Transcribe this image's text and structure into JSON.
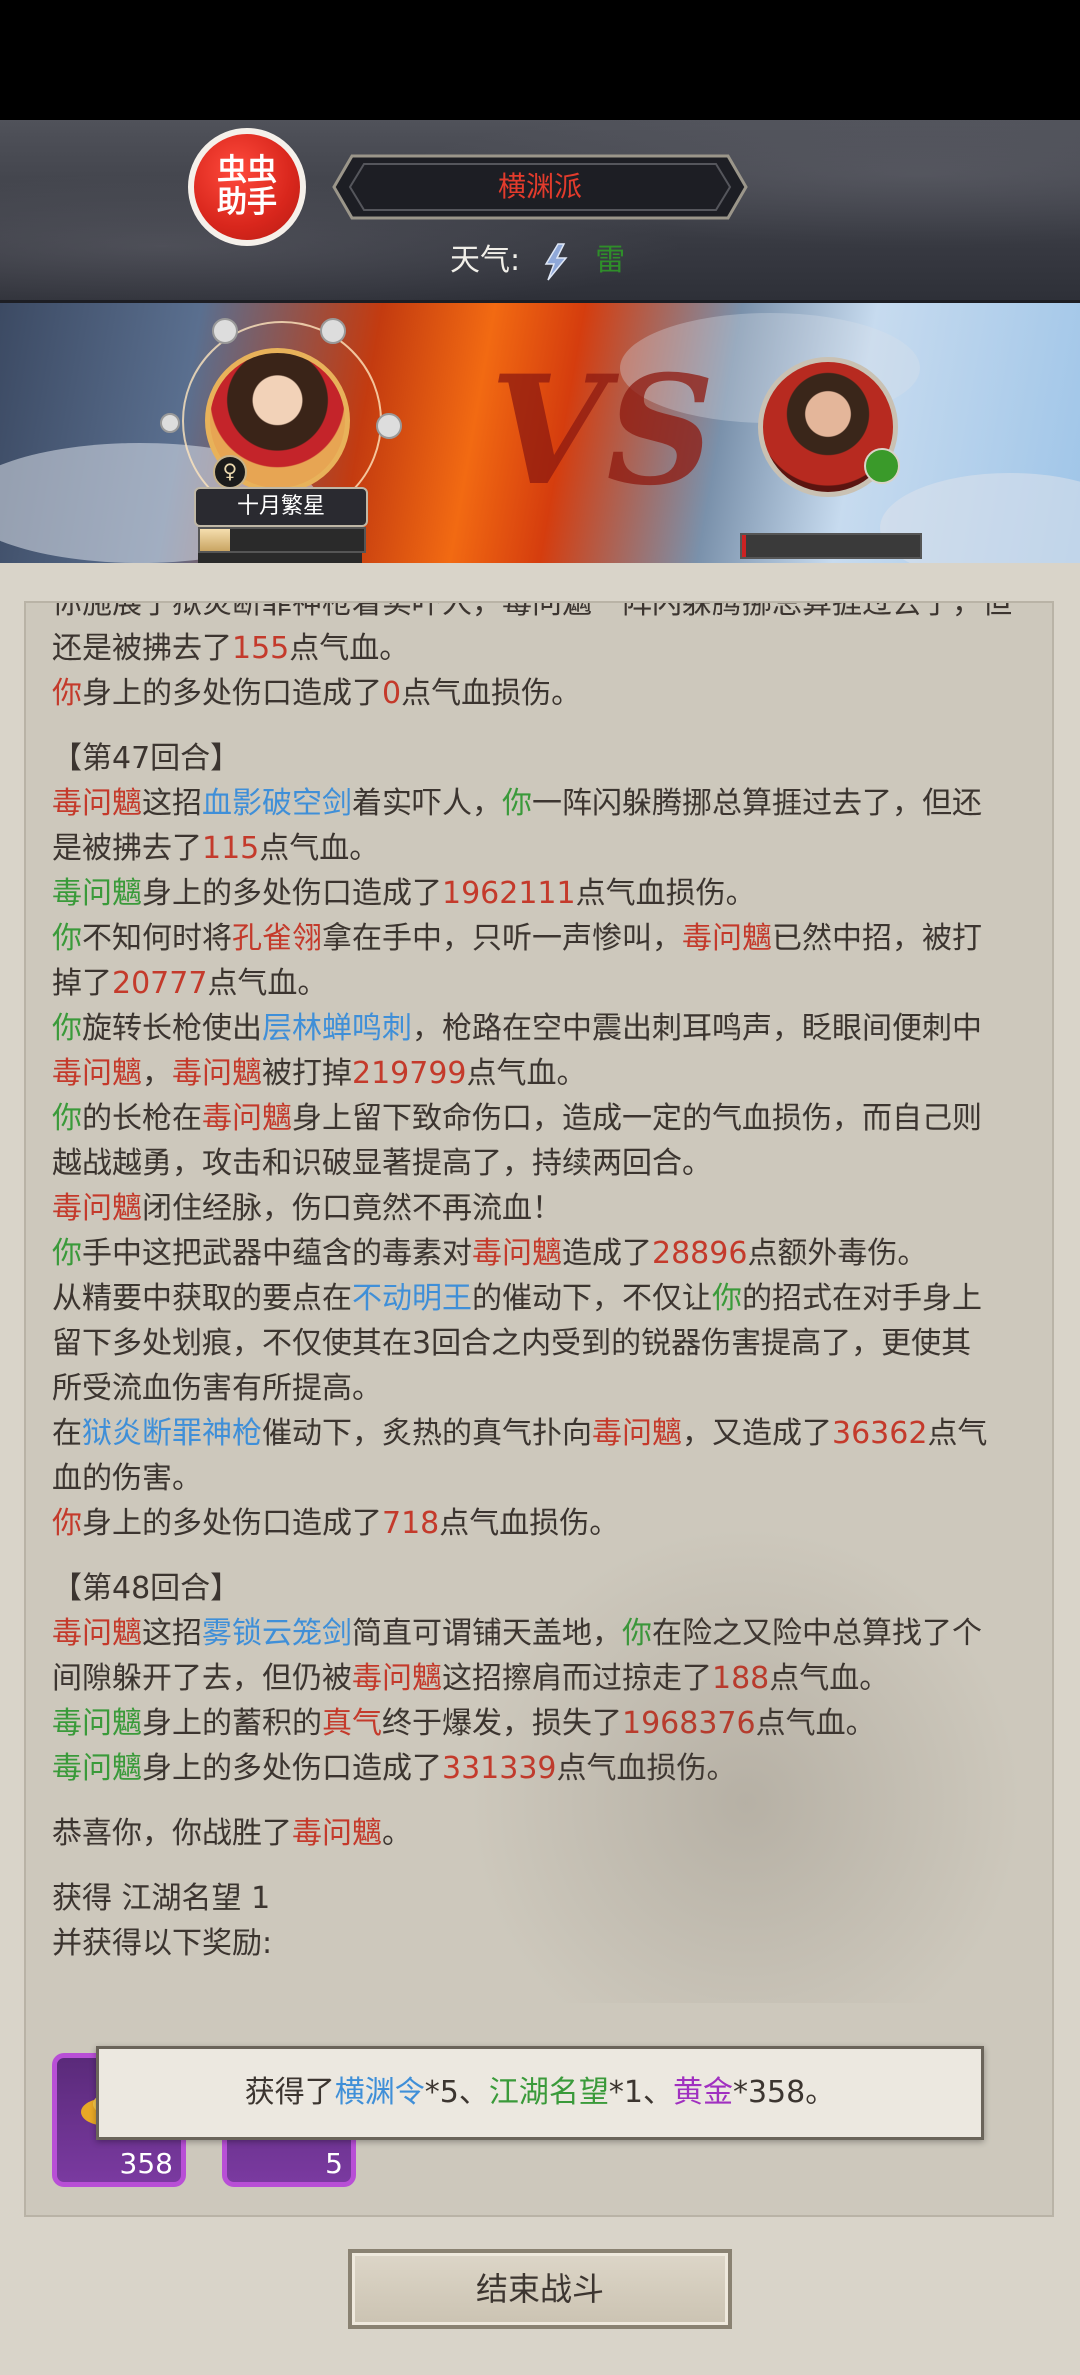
{
  "header": {
    "helper_label": "虫虫助手",
    "sect_name": "横渊派",
    "weather_label": "天气:",
    "weather_value": "雷",
    "weather_icon": "lightning-icon"
  },
  "battle": {
    "vs_text": "VS",
    "player_name": "十月繁星",
    "player_hp_fraction": 0.18,
    "enemy_hp_fraction": 0.02
  },
  "log": {
    "lines": [
      [
        {
          "t": "你施展了",
          "c": "cut"
        },
        {
          "t": "狱炎断罪神枪",
          "c": "cut"
        },
        {
          "t": "着实吓人，",
          "c": "cut"
        },
        {
          "t": "毒问魑",
          "c": "cut"
        },
        {
          "t": "一阵闪躲腾挪总算捱过去了，但",
          "c": "cut"
        }
      ],
      [
        {
          "t": "还是被拂去了"
        },
        {
          "t": "155",
          "c": "n"
        },
        {
          "t": "点气血。"
        }
      ],
      [
        {
          "t": "你",
          "c": "r"
        },
        {
          "t": "身上的多处伤口造成了"
        },
        {
          "t": "0",
          "c": "n"
        },
        {
          "t": "点气血损伤。"
        }
      ],
      "gap",
      [
        {
          "t": "【第47回合】"
        }
      ],
      [
        {
          "t": "毒问魑",
          "c": "r"
        },
        {
          "t": "这招"
        },
        {
          "t": "血影破空剑",
          "c": "b"
        },
        {
          "t": "着实吓人，"
        },
        {
          "t": "你",
          "c": "g"
        },
        {
          "t": "一阵闪躲腾挪总算捱过去了，但还"
        }
      ],
      [
        {
          "t": "是被拂去了"
        },
        {
          "t": "115",
          "c": "n"
        },
        {
          "t": "点气血。"
        }
      ],
      [
        {
          "t": "毒问魑",
          "c": "g"
        },
        {
          "t": "身上的多处伤口造成了"
        },
        {
          "t": "1962111",
          "c": "n"
        },
        {
          "t": "点气血损伤。"
        }
      ],
      [
        {
          "t": "你",
          "c": "g"
        },
        {
          "t": "不知何时将"
        },
        {
          "t": "孔雀翎",
          "c": "r"
        },
        {
          "t": "拿在手中，只听一声惨叫，"
        },
        {
          "t": "毒问魑",
          "c": "r"
        },
        {
          "t": "已然中招，被打"
        }
      ],
      [
        {
          "t": "掉了"
        },
        {
          "t": "20777",
          "c": "n"
        },
        {
          "t": "点气血。"
        }
      ],
      [
        {
          "t": "你",
          "c": "g"
        },
        {
          "t": "旋转长枪使出"
        },
        {
          "t": "层林蝉鸣刺",
          "c": "b"
        },
        {
          "t": "，枪路在空中震出刺耳鸣声，眨眼间便刺中"
        }
      ],
      [
        {
          "t": "毒问魑",
          "c": "r"
        },
        {
          "t": "，"
        },
        {
          "t": "毒问魑",
          "c": "r"
        },
        {
          "t": "被打掉"
        },
        {
          "t": "219799",
          "c": "n"
        },
        {
          "t": "点气血。"
        }
      ],
      [
        {
          "t": "你",
          "c": "g"
        },
        {
          "t": "的长枪在"
        },
        {
          "t": "毒问魑",
          "c": "r"
        },
        {
          "t": "身上留下致命伤口，造成一定的气血损伤，而自己则"
        }
      ],
      [
        {
          "t": "越战越勇，攻击和识破显著提高了，持续两回合。"
        }
      ],
      [
        {
          "t": "毒问魑",
          "c": "r"
        },
        {
          "t": "闭住经脉，伤口竟然不再流血！"
        }
      ],
      [
        {
          "t": "你",
          "c": "g"
        },
        {
          "t": "手中这把武器中蕴含的毒素对"
        },
        {
          "t": "毒问魑",
          "c": "r"
        },
        {
          "t": "造成了"
        },
        {
          "t": "28896",
          "c": "n"
        },
        {
          "t": "点额外毒伤。"
        }
      ],
      [
        {
          "t": "从精要中获取的要点在"
        },
        {
          "t": "不动明王",
          "c": "b"
        },
        {
          "t": "的催动下，不仅让"
        },
        {
          "t": "你",
          "c": "g"
        },
        {
          "t": "的招式在对手身上"
        }
      ],
      [
        {
          "t": "留下多处划痕，不仅使其在3回合之内受到的锐器伤害提高了，更使其"
        }
      ],
      [
        {
          "t": "所受流血伤害有所提高。"
        }
      ],
      [
        {
          "t": "在"
        },
        {
          "t": "狱炎断罪神枪",
          "c": "b"
        },
        {
          "t": "催动下，炙热的真气扑向"
        },
        {
          "t": "毒问魑",
          "c": "r"
        },
        {
          "t": "，又造成了"
        },
        {
          "t": "36362",
          "c": "n"
        },
        {
          "t": "点气"
        }
      ],
      [
        {
          "t": "血的伤害。"
        }
      ],
      [
        {
          "t": "你",
          "c": "r"
        },
        {
          "t": "身上的多处伤口造成了"
        },
        {
          "t": "718",
          "c": "n"
        },
        {
          "t": "点气血损伤。"
        }
      ],
      "gap",
      [
        {
          "t": "【第48回合】"
        }
      ],
      [
        {
          "t": "毒问魑",
          "c": "r"
        },
        {
          "t": "这招"
        },
        {
          "t": "雾锁云笼剑",
          "c": "b"
        },
        {
          "t": "简直可谓铺天盖地，"
        },
        {
          "t": "你",
          "c": "g"
        },
        {
          "t": "在险之又险中总算找了个"
        }
      ],
      [
        {
          "t": "间隙躲开了去，但仍被"
        },
        {
          "t": "毒问魑",
          "c": "r"
        },
        {
          "t": "这招擦肩而过掠走了"
        },
        {
          "t": "188",
          "c": "n"
        },
        {
          "t": "点气血。"
        }
      ],
      [
        {
          "t": "毒问魑",
          "c": "g"
        },
        {
          "t": "身上的蓄积的"
        },
        {
          "t": "真气",
          "c": "r"
        },
        {
          "t": "终于爆发，损失了"
        },
        {
          "t": "1968376",
          "c": "n"
        },
        {
          "t": "点气血。"
        }
      ],
      [
        {
          "t": "毒问魑",
          "c": "g"
        },
        {
          "t": "身上的多处伤口造成了"
        },
        {
          "t": "331339",
          "c": "n"
        },
        {
          "t": "点气血损伤。"
        }
      ],
      "gap",
      [
        {
          "t": "恭喜你，你战胜了"
        },
        {
          "t": "毒问魑",
          "c": "r"
        },
        {
          "t": "。"
        }
      ],
      "gap",
      [
        {
          "t": "获得 "
        },
        {
          "t": "江湖名望 1"
        }
      ],
      [
        {
          "t": "并获得以下奖励:"
        }
      ]
    ]
  },
  "rewards": {
    "items": [
      {
        "name": "gold-item",
        "count": "358"
      },
      {
        "name": "token-item",
        "count": "5"
      }
    ]
  },
  "toast": {
    "prefix": "获得了",
    "item1": "横渊令",
    "count1": "*5、",
    "item2": "江湖名望",
    "count2": "*1、",
    "item3": "黄金",
    "count3": "*358。"
  },
  "end_button_label": "结束战斗"
}
